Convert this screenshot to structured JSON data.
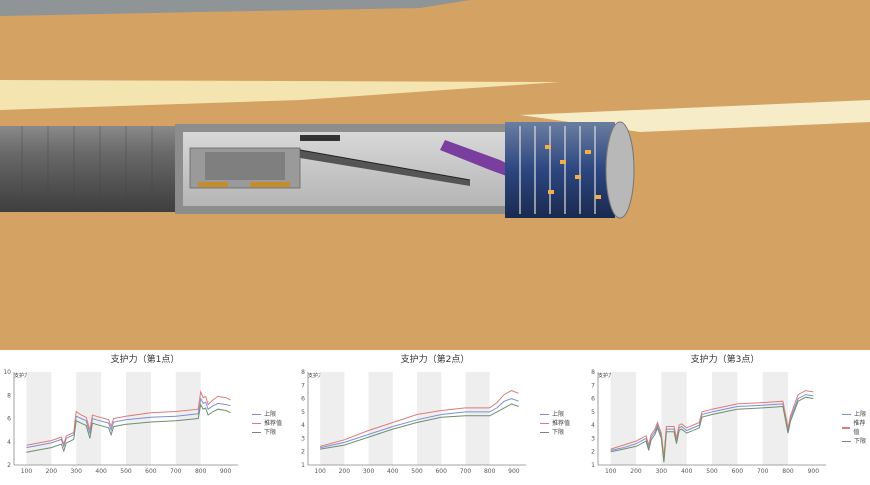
{
  "colors": {
    "upper": "#7b8fd6",
    "recommended": "#e07a7a",
    "lower": "#6e8f6e",
    "band": "#eeeeee",
    "soil": "#d4a262"
  },
  "charts": [
    {
      "title": "支护力（第1点）",
      "unit": "支护力(Bar)",
      "legend": [
        "上限",
        "推荐值",
        "下限"
      ],
      "chart_data": {
        "type": "line",
        "xlim": [
          50,
          950
        ],
        "ylim": [
          2,
          10
        ],
        "xticks": [
          100,
          200,
          300,
          400,
          500,
          600,
          700,
          800,
          900
        ],
        "yticks": [
          2,
          4,
          6,
          8,
          10
        ],
        "series": [
          {
            "name": "上限",
            "x": [
              100,
              150,
              200,
              240,
              250,
              260,
              270,
              290,
              300,
              320,
              340,
              355,
              365,
              380,
              430,
              440,
              450,
              500,
              600,
              700,
              790,
              800,
              810,
              820,
              830,
              850,
              870,
              900,
              920
            ],
            "y": [
              3.5,
              3.7,
              3.9,
              4.2,
              3.6,
              4.3,
              4.4,
              4.6,
              6.2,
              6.0,
              5.8,
              4.7,
              6.0,
              5.9,
              5.6,
              5.0,
              5.7,
              5.9,
              6.1,
              6.2,
              6.4,
              7.7,
              7.3,
              7.4,
              6.8,
              7.1,
              7.3,
              7.2,
              7.1
            ]
          },
          {
            "name": "推荐值",
            "x": [
              100,
              150,
              200,
              240,
              250,
              260,
              270,
              290,
              300,
              320,
              340,
              355,
              365,
              380,
              430,
              440,
              450,
              500,
              600,
              700,
              790,
              800,
              810,
              820,
              830,
              850,
              870,
              900,
              920
            ],
            "y": [
              3.7,
              3.9,
              4.1,
              4.4,
              3.8,
              4.5,
              4.6,
              4.8,
              6.6,
              6.3,
              6.1,
              5.0,
              6.3,
              6.2,
              5.9,
              5.3,
              6.0,
              6.2,
              6.5,
              6.6,
              6.8,
              8.3,
              7.8,
              7.9,
              7.2,
              7.6,
              7.9,
              7.8,
              7.6
            ]
          },
          {
            "name": "下限",
            "x": [
              100,
              150,
              200,
              240,
              250,
              260,
              270,
              290,
              300,
              320,
              340,
              355,
              365,
              380,
              430,
              440,
              450,
              500,
              600,
              700,
              790,
              800,
              810,
              820,
              830,
              850,
              870,
              900,
              920
            ],
            "y": [
              3.1,
              3.3,
              3.5,
              3.8,
              3.2,
              3.9,
              4.0,
              4.2,
              5.8,
              5.6,
              5.4,
              4.3,
              5.6,
              5.5,
              5.2,
              4.6,
              5.3,
              5.5,
              5.7,
              5.8,
              6.0,
              7.2,
              6.8,
              6.9,
              6.3,
              6.6,
              6.8,
              6.7,
              6.5
            ]
          }
        ]
      }
    },
    {
      "title": "支护力（第2点）",
      "unit": "支护力(Bar)",
      "legend": [
        "上限",
        "推荐值",
        "下限"
      ],
      "chart_data": {
        "type": "line",
        "xlim": [
          50,
          950
        ],
        "ylim": [
          1,
          8
        ],
        "xticks": [
          100,
          200,
          300,
          400,
          500,
          600,
          700,
          800,
          900
        ],
        "yticks": [
          1,
          2,
          3,
          4,
          5,
          6,
          7,
          8
        ],
        "series": [
          {
            "name": "上限",
            "x": [
              100,
              200,
              300,
              400,
              500,
              600,
              700,
              800,
              830,
              860,
              890,
              920
            ],
            "y": [
              2.3,
              2.7,
              3.3,
              3.9,
              4.4,
              4.8,
              5.0,
              5.0,
              5.3,
              5.8,
              6.0,
              5.8
            ]
          },
          {
            "name": "推荐值",
            "x": [
              100,
              200,
              300,
              400,
              500,
              600,
              700,
              800,
              830,
              860,
              890,
              920
            ],
            "y": [
              2.4,
              2.9,
              3.6,
              4.2,
              4.8,
              5.1,
              5.3,
              5.3,
              5.7,
              6.3,
              6.6,
              6.4
            ]
          },
          {
            "name": "下限",
            "x": [
              100,
              200,
              300,
              400,
              500,
              600,
              700,
              800,
              830,
              860,
              890,
              920
            ],
            "y": [
              2.2,
              2.5,
              3.1,
              3.7,
              4.2,
              4.6,
              4.7,
              4.7,
              5.0,
              5.3,
              5.6,
              5.4
            ]
          }
        ]
      }
    },
    {
      "title": "支护力（第3点）",
      "unit": "支护力(Bar)",
      "legend": [
        "上限",
        "推荐值",
        "下限"
      ],
      "chart_data": {
        "type": "line",
        "xlim": [
          50,
          950
        ],
        "ylim": [
          1,
          8
        ],
        "xticks": [
          100,
          200,
          300,
          400,
          500,
          600,
          700,
          800,
          900
        ],
        "yticks": [
          1,
          2,
          3,
          4,
          5,
          6,
          7,
          8
        ],
        "series": [
          {
            "name": "上限",
            "x": [
              100,
              150,
              200,
              240,
              250,
              260,
              275,
              285,
              300,
              310,
              320,
              350,
              360,
              370,
              380,
              400,
              450,
              460,
              500,
              600,
              700,
              780,
              800,
              810,
              840,
              870,
              900
            ],
            "y": [
              2.1,
              2.3,
              2.6,
              3.0,
              2.3,
              3.1,
              3.5,
              4.0,
              3.2,
              1.4,
              3.7,
              3.7,
              2.8,
              3.8,
              3.9,
              3.6,
              4.0,
              4.8,
              5.0,
              5.4,
              5.5,
              5.6,
              3.6,
              4.5,
              6.0,
              6.3,
              6.2
            ]
          },
          {
            "name": "推荐值",
            "x": [
              100,
              150,
              200,
              240,
              250,
              260,
              275,
              285,
              300,
              310,
              320,
              350,
              360,
              370,
              380,
              400,
              450,
              460,
              500,
              600,
              700,
              780,
              800,
              810,
              840,
              870,
              900
            ],
            "y": [
              2.2,
              2.5,
              2.8,
              3.2,
              2.5,
              3.3,
              3.7,
              4.2,
              3.4,
              1.6,
              3.9,
              3.9,
              3.0,
              4.0,
              4.1,
              3.8,
              4.2,
              5.0,
              5.2,
              5.6,
              5.7,
              5.8,
              3.8,
              4.7,
              6.3,
              6.6,
              6.5
            ]
          },
          {
            "name": "下限",
            "x": [
              100,
              150,
              200,
              240,
              250,
              260,
              275,
              285,
              300,
              310,
              320,
              350,
              360,
              370,
              380,
              400,
              450,
              460,
              500,
              600,
              700,
              780,
              800,
              810,
              840,
              870,
              900
            ],
            "y": [
              2.0,
              2.2,
              2.4,
              2.8,
              2.1,
              2.9,
              3.3,
              3.8,
              3.0,
              1.2,
              3.5,
              3.5,
              2.6,
              3.6,
              3.7,
              3.4,
              3.8,
              4.6,
              4.8,
              5.2,
              5.3,
              5.4,
              3.4,
              4.3,
              5.8,
              6.1,
              6.0
            ]
          }
        ]
      }
    }
  ]
}
